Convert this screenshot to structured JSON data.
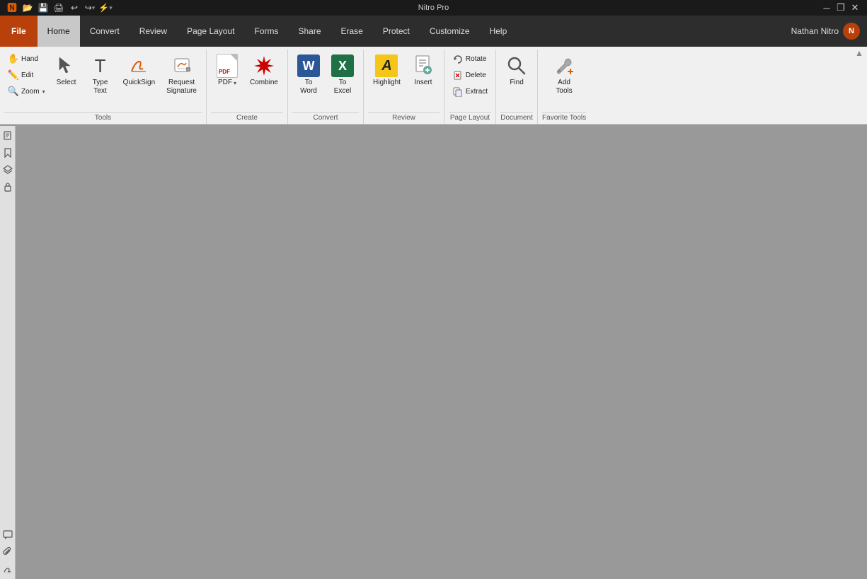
{
  "app": {
    "title": "Nitro Pro",
    "user": {
      "name": "Nathan Nitro",
      "initials": "N"
    }
  },
  "titlebar": {
    "minimize": "—",
    "restore": "❐",
    "close": "✕",
    "quickaccess": [
      "🅽",
      "📂",
      "💾",
      "🖨",
      "↩",
      "↪",
      "⚡",
      "⚡"
    ]
  },
  "menubar": {
    "tabs": [
      {
        "label": "File",
        "id": "file",
        "type": "file"
      },
      {
        "label": "Home",
        "id": "home",
        "type": "active"
      },
      {
        "label": "Convert",
        "id": "convert"
      },
      {
        "label": "Review",
        "id": "review"
      },
      {
        "label": "Page Layout",
        "id": "pagelayout"
      },
      {
        "label": "Forms",
        "id": "forms"
      },
      {
        "label": "Share",
        "id": "share"
      },
      {
        "label": "Erase",
        "id": "erase"
      },
      {
        "label": "Protect",
        "id": "protect"
      },
      {
        "label": "Customize",
        "id": "customize"
      },
      {
        "label": "Help",
        "id": "help"
      }
    ]
  },
  "ribbon": {
    "groups": [
      {
        "id": "tools",
        "label": "Tools",
        "items": [
          {
            "id": "hand",
            "label": "Hand",
            "icon": "hand",
            "size": "small"
          },
          {
            "id": "edit",
            "label": "Edit",
            "icon": "edit",
            "size": "small"
          },
          {
            "id": "zoom",
            "label": "Zoom",
            "icon": "zoom",
            "size": "small",
            "hasArrow": true
          },
          {
            "id": "select",
            "label": "Select",
            "icon": "select",
            "size": "large"
          },
          {
            "id": "typetext",
            "label": "Type\nText",
            "icon": "typetext",
            "size": "large"
          },
          {
            "id": "quicksign",
            "label": "QuickSign",
            "icon": "quicksign",
            "size": "large"
          },
          {
            "id": "requestsig",
            "label": "Request\nSignature",
            "icon": "requestsig",
            "size": "large"
          }
        ]
      },
      {
        "id": "create",
        "label": "Create",
        "items": [
          {
            "id": "pdf",
            "label": "PDF",
            "icon": "pdf",
            "size": "large",
            "hasArrow": true
          },
          {
            "id": "combine",
            "label": "Combine",
            "icon": "combine",
            "size": "large"
          }
        ]
      },
      {
        "id": "convert",
        "label": "Convert",
        "sublabel": "Convert",
        "items": [
          {
            "id": "toword",
            "label": "To\nWord",
            "icon": "word",
            "size": "large"
          },
          {
            "id": "toexcel",
            "label": "To\nExcel",
            "icon": "excel",
            "size": "large"
          }
        ]
      },
      {
        "id": "review",
        "label": "Review",
        "items": [
          {
            "id": "highlight",
            "label": "Highlight",
            "icon": "highlight",
            "size": "large"
          },
          {
            "id": "insert",
            "label": "Insert",
            "icon": "insert",
            "size": "large"
          }
        ]
      },
      {
        "id": "pagelayout",
        "label": "Page Layout",
        "items": [
          {
            "id": "rotate",
            "label": "Rotate",
            "icon": "rotate",
            "size": "small"
          },
          {
            "id": "delete",
            "label": "Delete",
            "icon": "delete",
            "size": "small"
          },
          {
            "id": "extract",
            "label": "Extract",
            "icon": "extract",
            "size": "small"
          }
        ]
      },
      {
        "id": "document",
        "label": "Document",
        "items": [
          {
            "id": "find",
            "label": "Find",
            "icon": "find",
            "size": "large"
          }
        ]
      },
      {
        "id": "favoritetools",
        "label": "Favorite Tools",
        "items": [
          {
            "id": "addtools",
            "label": "Add\nTools",
            "icon": "addtools",
            "size": "large"
          }
        ]
      }
    ]
  },
  "sidebar": {
    "top_icons": [
      "pages",
      "bookmarks",
      "layers",
      "security"
    ],
    "bottom_icons": [
      "comments",
      "attachments",
      "signatures"
    ]
  }
}
